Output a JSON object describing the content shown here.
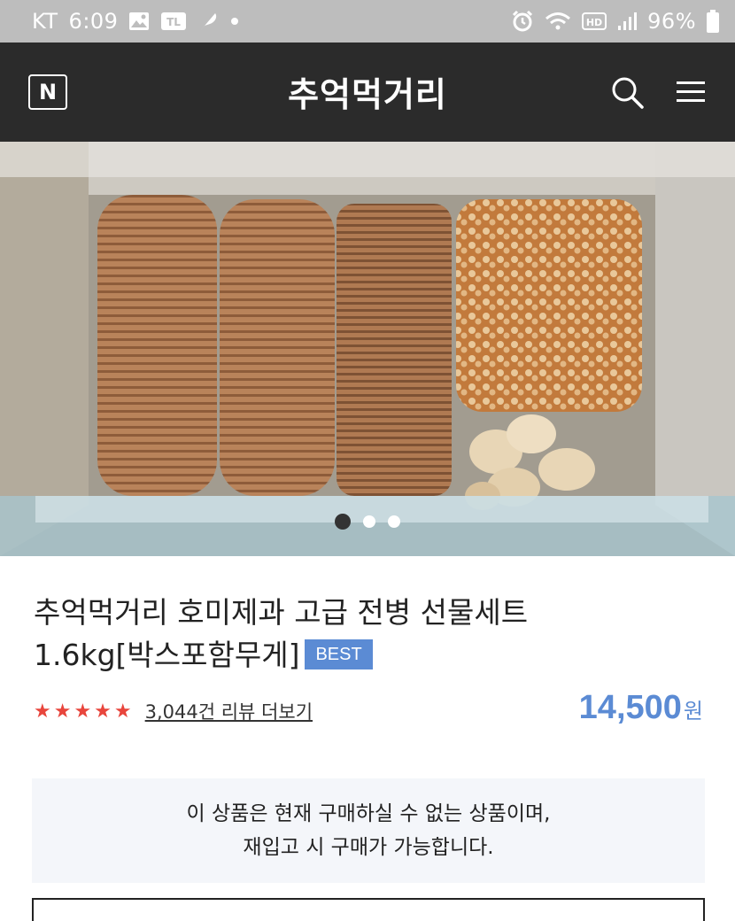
{
  "status_bar": {
    "carrier": "KT",
    "time": "6:09",
    "battery": "96%",
    "icons": [
      "image-icon",
      "talk-icon",
      "feather-icon",
      "dot-icon",
      "alarm-icon",
      "wifi-icon",
      "hd-icon",
      "signal-icon",
      "battery-icon"
    ]
  },
  "header": {
    "logo": "N",
    "title": "추억먹거리",
    "icons": [
      "search-icon",
      "menu-icon"
    ]
  },
  "carousel": {
    "total": 3,
    "active_index": 0
  },
  "product": {
    "title_line1": "추억먹거리 호미제과 고급 전병 선물세트",
    "title_line2": "1.6kg[박스포함무게]",
    "badge": "BEST",
    "rating_stars": 5,
    "stars_text": "★★★★★",
    "review_link": "3,044건 리뷰 더보기",
    "price": "14,500",
    "price_unit": "원"
  },
  "notice": {
    "line1": "이 상품은 현재 구매하실 수 없는 상품이며,",
    "line2": "재입고 시 구매가 가능합니다."
  },
  "colors": {
    "status_bar_bg": "#bdbdbd",
    "header_bg": "#2b2b2b",
    "accent_blue": "#5b8bd4",
    "star_red": "#e8453c",
    "notice_bg": "#f4f6fa"
  }
}
